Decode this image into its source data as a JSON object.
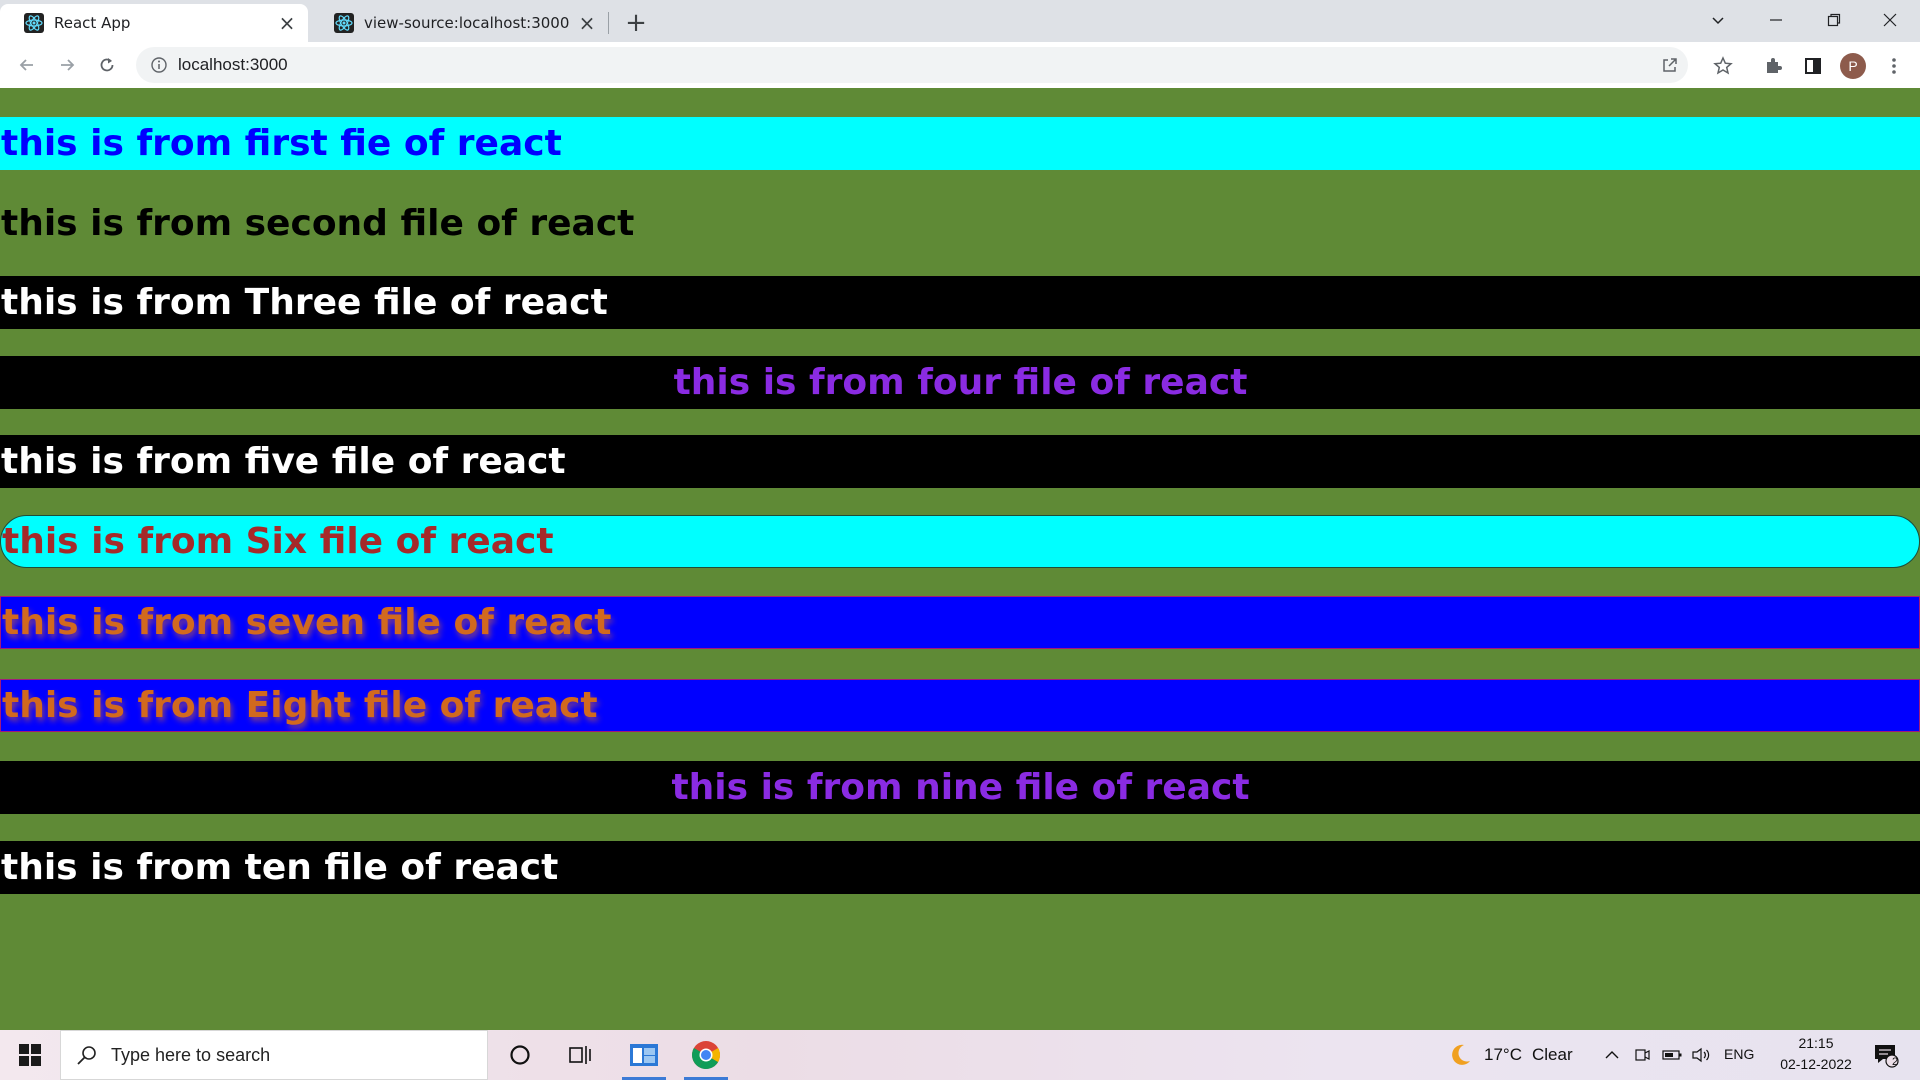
{
  "browser": {
    "tabs": [
      {
        "title": "React App",
        "icon": "react-logo-icon",
        "active": true
      },
      {
        "title": "view-source:localhost:3000",
        "icon": "react-logo-icon",
        "active": false
      }
    ],
    "address": "localhost:3000",
    "profile_initial": "P"
  },
  "page": {
    "banners": [
      {
        "text": "this is from first fie of react",
        "bg": "#00ffff",
        "color": "#0000ff"
      },
      {
        "text": "this is from second file of react",
        "bg": "#5f8a36",
        "color": "#000000"
      },
      {
        "text": "this is from Three file of react",
        "bg": "#000000",
        "color": "#ffffff"
      },
      {
        "text": "this is from four file of react",
        "bg": "#000000",
        "color": "#8a2be2"
      },
      {
        "text": "this is from five file of react",
        "bg": "#000000",
        "color": "#ffffff"
      },
      {
        "text": "this is from Six file of react",
        "bg": "#00ffff",
        "color": "#a52a2a"
      },
      {
        "text": "this is from seven file of react",
        "bg": "#0000ff",
        "color": "#d2691e"
      },
      {
        "text": "this is from Eight file of react",
        "bg": "#0000ff",
        "color": "#d2691e"
      },
      {
        "text": "this is from nine file of react",
        "bg": "#000000",
        "color": "#8a2be2"
      },
      {
        "text": "this is from ten file of react",
        "bg": "#000000",
        "color": "#ffffff"
      }
    ],
    "background": "#5f8a36"
  },
  "taskbar": {
    "search_placeholder": "Type here to search",
    "weather": {
      "temp": "17°C",
      "condition": "Clear"
    },
    "language": "ENG",
    "time": "21:15",
    "date": "02-12-2022",
    "notification_count": "2"
  }
}
